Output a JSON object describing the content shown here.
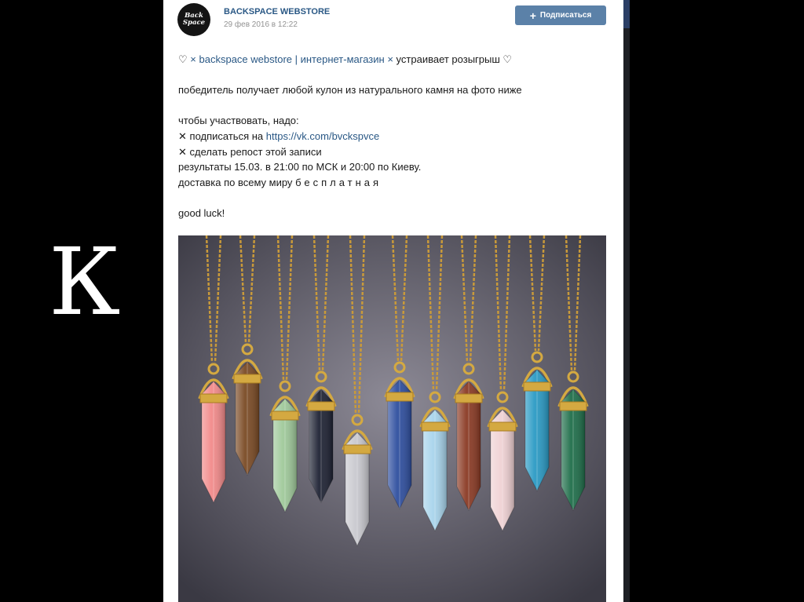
{
  "slide": {
    "letter": "К"
  },
  "post": {
    "author": "BACKSPACE WEBSTORE",
    "date": "29 фев 2016 в 12:22",
    "avatar_text": [
      "Back",
      "Space"
    ],
    "subscribe_label": "Подписаться",
    "lines": {
      "l1": {
        "heart1": "♡",
        "x1": "×",
        "name": "backspace webstore | интернет-магазин",
        "x2": "×",
        "rest": "устраивает розыгрыш",
        "heart2": "♡"
      },
      "l2": "победитель получает любой кулон из натурального камня на фото ниже",
      "l3": "чтобы участвовать, надо:",
      "l4": {
        "mark": "✕",
        "text": "подписаться на",
        "url": "https://vk.com/bvckspvce"
      },
      "l5": {
        "mark": "✕",
        "text": "сделать репост этой записи"
      },
      "l6": "результаты 15.03. в 21:00 по МСК и 20:00 по Киеву.",
      "l7": {
        "text": "доставка по всему миру",
        "spaced": "бесплатная"
      },
      "l8": "good luck!"
    },
    "photo": {
      "icon": "crystal-pendants-photo",
      "pendants": [
        {
          "color": "#f28a8a"
        },
        {
          "color": "#7a4a24"
        },
        {
          "color": "#9fc99a"
        },
        {
          "color": "#1e2233"
        },
        {
          "color": "#c9c9cf"
        },
        {
          "color": "#2e4e9e"
        },
        {
          "color": "#a8d4ec"
        },
        {
          "color": "#8a3a24"
        },
        {
          "color": "#f0d2d4"
        },
        {
          "color": "#2a9ac4"
        },
        {
          "color": "#1f6e4a"
        }
      ]
    }
  },
  "colors": {
    "link": "#2a5885",
    "button": "#5b81a8",
    "background": "#000000"
  }
}
